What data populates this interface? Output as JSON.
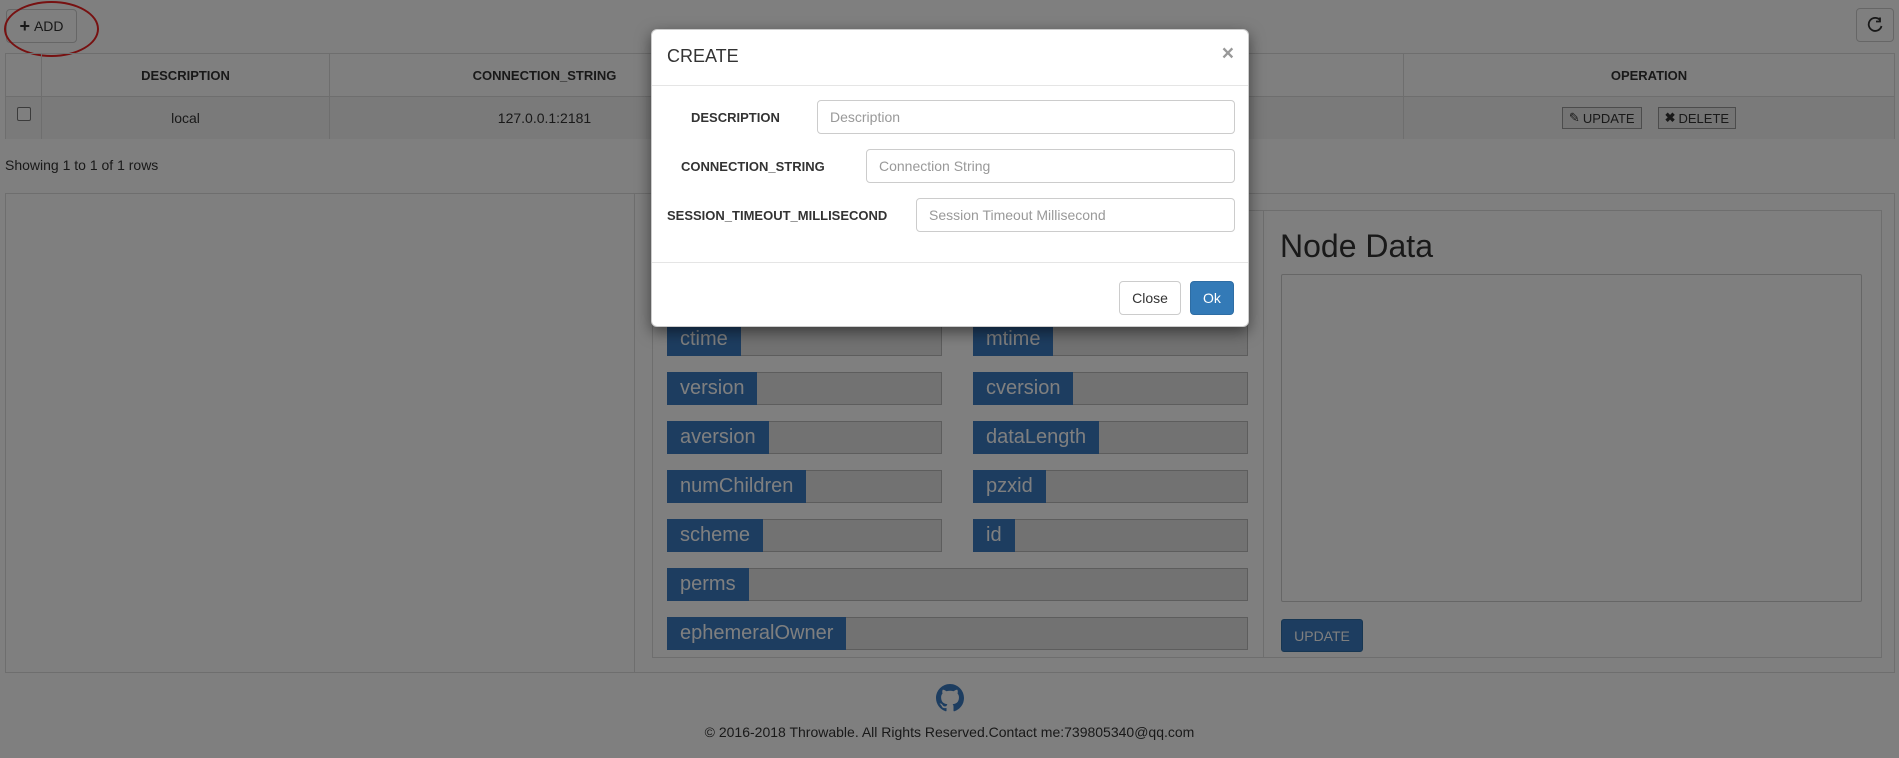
{
  "toolbar": {
    "add_label": "ADD",
    "add_icon": "plus-icon",
    "refresh_icon": "refresh-icon"
  },
  "table": {
    "columns": [
      "",
      "DESCRIPTION",
      "CONNECTION_STRING",
      "",
      "OPERATION"
    ],
    "rows": [
      {
        "checked": false,
        "description": "local",
        "connection_string": "127.0.0.1:2181"
      }
    ],
    "update_label": "UPDATE",
    "delete_label": "DELETE",
    "update_icon": "edit-icon",
    "delete_icon": "close-icon"
  },
  "pagination": {
    "showing": "Showing 1 to 1 of 1 rows"
  },
  "stat_fields": [
    "ctime",
    "mtime",
    "version",
    "cversion",
    "aversion",
    "dataLength",
    "numChildren",
    "pzxid",
    "scheme",
    "id",
    "perms",
    "ephemeralOwner"
  ],
  "node_data": {
    "title": "Node Data",
    "value": "",
    "update_label": "UPDATE"
  },
  "footer": {
    "icon": "github-icon",
    "text": "© 2016-2018 Throwable. All Rights Reserved.Contact me:739805340@qq.com"
  },
  "modal": {
    "title": "CREATE",
    "close_glyph": "×",
    "fields": [
      {
        "label": "DESCRIPTION",
        "placeholder": "Description",
        "value": ""
      },
      {
        "label": "CONNECTION_STRING",
        "placeholder": "Connection String",
        "value": ""
      },
      {
        "label": "SESSION_TIMEOUT_MILLISECOND",
        "placeholder": "Session Timeout Millisecond",
        "value": ""
      }
    ],
    "close_label": "Close",
    "ok_label": "Ok"
  },
  "colors": {
    "primary": "#337ab7",
    "field_label": "#3a7ac0",
    "annotation": "#e22222"
  }
}
